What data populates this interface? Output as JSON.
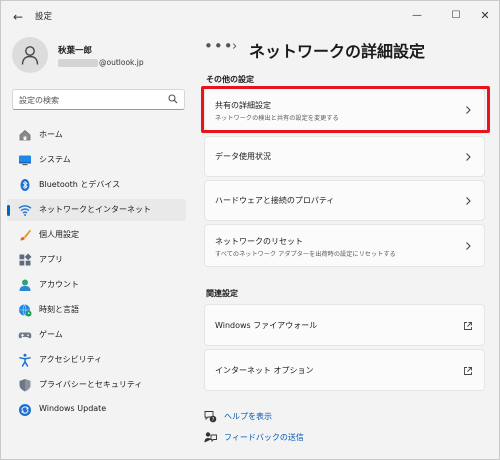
{
  "window": {
    "title": "設定",
    "back_glyph": "←",
    "min_glyph": "—",
    "max_glyph": "☐",
    "close_glyph": "✕"
  },
  "profile": {
    "name": "秋葉一郎",
    "email_suffix": "@outlook.jp"
  },
  "search": {
    "placeholder": "設定の検索"
  },
  "sidebar": {
    "items": [
      {
        "label": "ホーム",
        "icon": "home-icon",
        "active": false
      },
      {
        "label": "システム",
        "icon": "system-icon",
        "active": false
      },
      {
        "label": "Bluetooth とデバイス",
        "icon": "bluetooth-icon",
        "active": false
      },
      {
        "label": "ネットワークとインターネット",
        "icon": "wifi-icon",
        "active": true
      },
      {
        "label": "個人用設定",
        "icon": "brush-icon",
        "active": false
      },
      {
        "label": "アプリ",
        "icon": "apps-icon",
        "active": false
      },
      {
        "label": "アカウント",
        "icon": "account-icon",
        "active": false
      },
      {
        "label": "時刻と言語",
        "icon": "globe-clock-icon",
        "active": false
      },
      {
        "label": "ゲーム",
        "icon": "gamepad-icon",
        "active": false
      },
      {
        "label": "アクセシビリティ",
        "icon": "accessibility-icon",
        "active": false
      },
      {
        "label": "プライバシーとセキュリティ",
        "icon": "shield-icon",
        "active": false
      },
      {
        "label": "Windows Update",
        "icon": "update-icon",
        "active": false
      }
    ]
  },
  "breadcrumb": {
    "more": "•••",
    "separator": "›",
    "title": "ネットワークの詳細設定"
  },
  "sections": {
    "other_header": "その他の設定",
    "related_header": "関連設定"
  },
  "cards": {
    "sharing": {
      "title": "共有の詳細設定",
      "subtitle": "ネットワークの検出と共有の設定を変更する"
    },
    "data_usage": {
      "title": "データ使用状況"
    },
    "hardware": {
      "title": "ハードウェアと接続のプロパティ"
    },
    "reset": {
      "title": "ネットワークのリセット",
      "subtitle": "すべてのネットワーク アダプターを出荷時の設定にリセットする"
    },
    "firewall": {
      "title": "Windows ファイアウォール"
    },
    "internet_options": {
      "title": "インターネット オプション"
    }
  },
  "links": {
    "help": "ヘルプを表示",
    "feedback": "フィードバックの送信"
  },
  "colors": {
    "accent": "#0067c0",
    "highlight": "#e8141b",
    "link": "#0059b3"
  }
}
